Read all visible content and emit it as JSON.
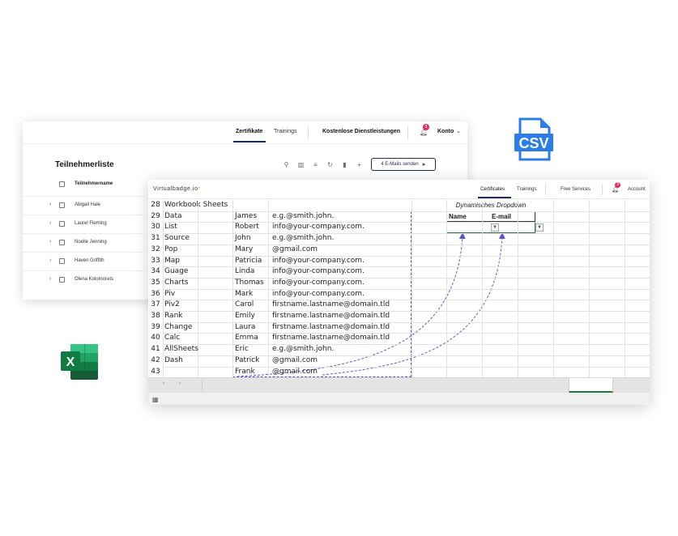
{
  "back_window": {
    "nav": {
      "certificates": "Zertifikate",
      "trainings": "Trainings",
      "free_services": "Kostenlose Dienstleistungen",
      "account": "Konto",
      "notification_count": "3"
    },
    "title": "Teilnehmerliste",
    "send_button": "4 E-Mails senden",
    "column_header": "Teilnehmername",
    "participants": [
      "Abigail Hale",
      "Laurel Fleming",
      "Noelle Jenning",
      "Haven Griffith",
      "Olena Kolomorets"
    ]
  },
  "front_window": {
    "logo": "Virtualbadge.io",
    "nav": {
      "certificates": "Certificates",
      "trainings": "Trainings",
      "free_services": "Free Services",
      "account": "Account",
      "notification_count": "3"
    },
    "sheet": {
      "row_numbers": [
        "28",
        "29",
        "30",
        "31",
        "32",
        "33",
        "34",
        "35",
        "36",
        "37",
        "38",
        "39",
        "40",
        "41",
        "42",
        "43"
      ],
      "header_cell": "Workbook Sheets",
      "col_a": [
        "Data",
        "List",
        "Source",
        "Pop",
        "Map",
        "Guage",
        "Charts",
        "Piv",
        "Piv2",
        "Rank",
        "Change",
        "Calc",
        "AllSheets",
        "Dash",
        ""
      ],
      "names": [
        "James",
        "Robert",
        "John",
        "Mary",
        "Patricia",
        "Linda",
        "Thomas",
        "Mark",
        "Carol",
        "Emily",
        "Laura",
        "Emma",
        "Eric",
        "Patrick",
        "Frank"
      ],
      "emails": [
        "e.g.@smith.john.",
        "info@your-company.com.",
        "e.g.@smith.john.",
        "@gmail.com",
        "info@your-company.com.",
        "info@your-company.com.",
        "info@your-company.com.",
        "info@your-company.com.",
        "firstname.lastname@domain.tld",
        "firstname.lastname@domain.tld",
        "firstname.lastname@domain.tld",
        "firstname.lastname@domain.tld",
        "e.g.@smith.john.",
        "@gmail.com",
        "@gmail.com"
      ],
      "dropdown_title": "Dynamisches Dropdown",
      "dropdown_name_header": "Name",
      "dropdown_email_header": "E-mail"
    }
  },
  "decor": {
    "csv_label": "CSV",
    "excel_letter": "X"
  },
  "colors": {
    "accent_navy": "#1e2a5a",
    "badge_pink": "#e8265f",
    "selection_green": "#1f7a3b",
    "marquee_blue": "#4a4ad4",
    "csv_blue": "#2b7de9",
    "excel_green": "#107c41"
  }
}
